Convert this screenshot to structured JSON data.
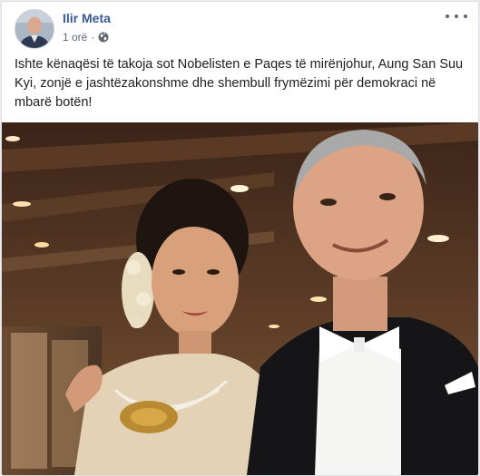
{
  "post": {
    "author_name": "Ilir Meta",
    "timestamp": "1 orë",
    "separator": "·",
    "privacy_icon": "globe-icon",
    "more_icon": "more-options-icon",
    "text": "Ishte kënaqësi të takoja sot Nobelisten e Paqes të mirënjohur, Aung San Suu Kyi, zonjë e jashtëzakonshme dhe shembull frymëzimi për demokraci në mbarë botën!"
  },
  "colors": {
    "author_link": "#385898",
    "secondary_text": "#606770",
    "body_text": "#1c1e21",
    "card_border": "#dddfe2"
  }
}
